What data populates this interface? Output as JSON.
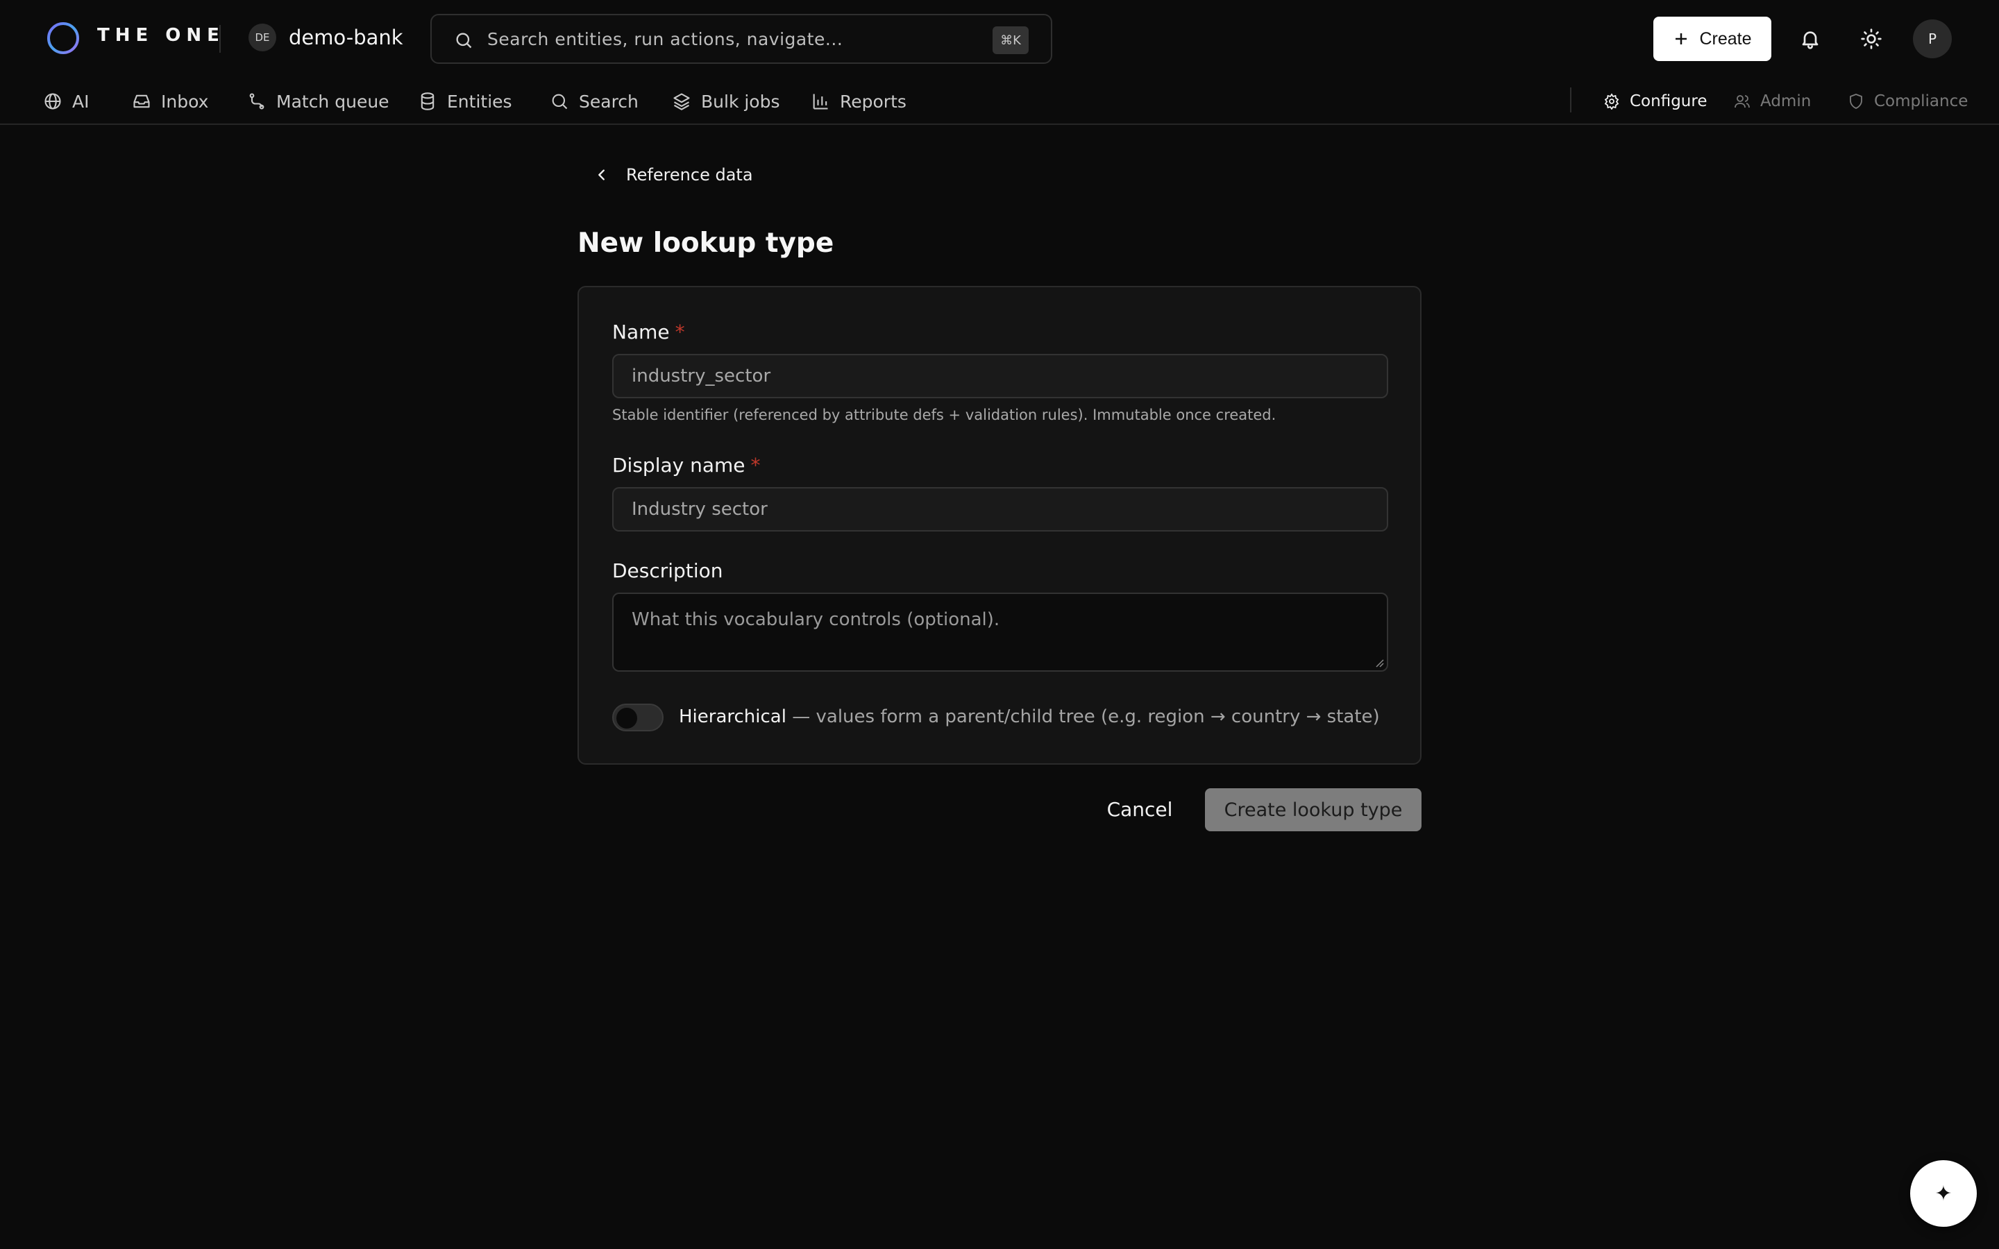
{
  "app": {
    "brand": "THE ONE",
    "tenant_badge": "DE",
    "tenant_name": "demo-bank"
  },
  "search": {
    "placeholder": "Search entities, run actions, navigate...",
    "shortcut": "⌘K"
  },
  "header": {
    "create_label": "Create",
    "avatar_initial": "P"
  },
  "nav": {
    "items": [
      {
        "label": "AI",
        "icon": "globe-icon"
      },
      {
        "label": "Inbox",
        "icon": "inbox-icon"
      },
      {
        "label": "Match queue",
        "icon": "route-icon"
      },
      {
        "label": "Entities",
        "icon": "database-icon"
      },
      {
        "label": "Search",
        "icon": "search-icon"
      },
      {
        "label": "Bulk jobs",
        "icon": "layers-icon"
      },
      {
        "label": "Reports",
        "icon": "bar-chart-icon"
      }
    ],
    "right": [
      {
        "label": "Configure",
        "icon": "gear-icon",
        "active": true
      },
      {
        "label": "Admin",
        "icon": "users-icon",
        "active": false
      },
      {
        "label": "Compliance",
        "icon": "shield-icon",
        "active": false
      }
    ]
  },
  "page": {
    "back_label": "Reference data",
    "title": "New lookup type"
  },
  "form": {
    "name_label": "Name",
    "name_placeholder": "industry_sector",
    "name_hint": "Stable identifier (referenced by attribute defs + validation rules). Immutable once created.",
    "display_label": "Display name",
    "display_placeholder": "Industry sector",
    "description_label": "Description",
    "description_placeholder": "What this vocabulary controls (optional).",
    "required_mark": "*",
    "hierarchical_label": "Hierarchical",
    "hierarchical_desc": " — values form a parent/child tree (e.g. region → country → state)",
    "hierarchical_on": false
  },
  "actions": {
    "cancel_label": "Cancel",
    "submit_label": "Create lookup type"
  },
  "fab": {
    "glyph": "✦",
    "icon": "sparkle-icon"
  },
  "colors": {
    "background": "#0b0b0b",
    "card": "#141414",
    "required": "#c0392b",
    "primary_button": "#ffffff",
    "disabled_button": "#7d7d7d"
  }
}
